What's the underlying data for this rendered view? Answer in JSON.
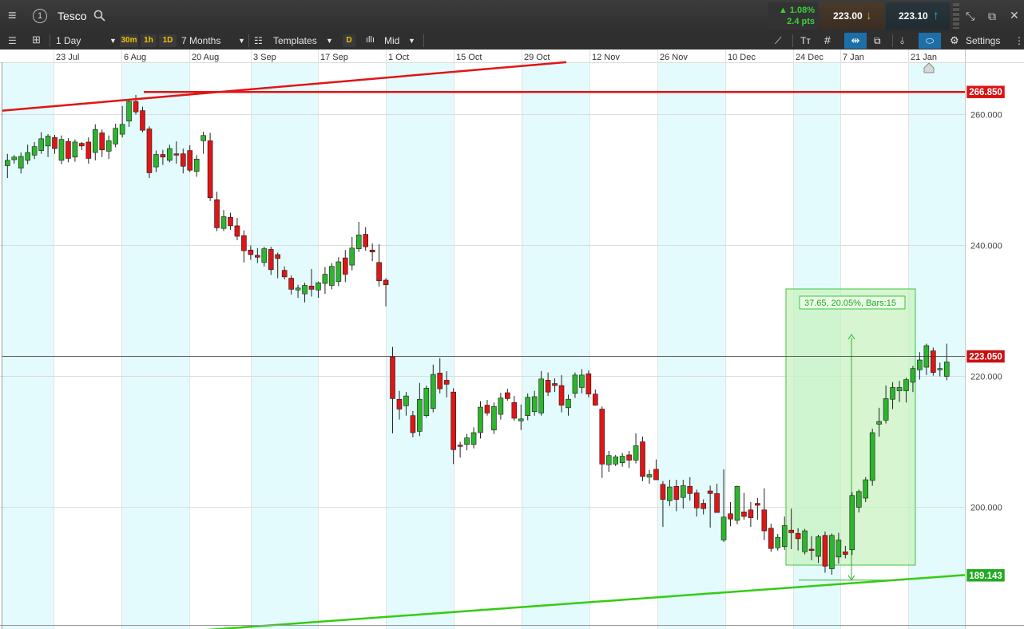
{
  "header": {
    "symbol": "Tesco",
    "change_pct": "▲ 1.08%",
    "change_pts": "2.4 pts",
    "sell_price": "223.00",
    "buy_price": "223.10",
    "sell_arrow": "↓",
    "buy_arrow": "↑"
  },
  "toolbar": {
    "interval": "1 Day",
    "quick_30m": "30m",
    "quick_1h": "1h",
    "quick_1d": "1D",
    "range": "7 Months",
    "templates": "Templates",
    "d_badge": "D",
    "price_type": "Mid",
    "text_tool": "Tт",
    "settings": "Settings"
  },
  "colors": {
    "up": "#2db52d",
    "down": "#e01515",
    "stripe": "#e4fbfd",
    "red_line": "#e01515",
    "green_line": "#33cc11",
    "measure_fill": "#c8f2c0",
    "current_badge": "#c81010",
    "support_badge": "#22aa22"
  },
  "chart_data": {
    "type": "candlestick",
    "x_ticks": [
      "23 Jul",
      "6 Aug",
      "20 Aug",
      "3 Sep",
      "17 Sep",
      "1 Oct",
      "15 Oct",
      "29 Oct",
      "12 Nov",
      "26 Nov",
      "10 Dec",
      "24 Dec",
      "7 Jan",
      "21 Jan"
    ],
    "y_ticks": [
      "260.000",
      "240.000",
      "220.000",
      "200.000"
    ],
    "y_tick_values": [
      260,
      240,
      220,
      200
    ],
    "ylim": [
      178,
      288
    ],
    "candles": [
      {
        "i": 0,
        "o": 252.2,
        "h": 254.0,
        "l": 250.3,
        "c": 253.0
      },
      {
        "i": 1,
        "o": 253.1,
        "h": 253.8,
        "l": 252.5,
        "c": 253.5
      },
      {
        "i": 2,
        "o": 251.8,
        "h": 254.2,
        "l": 251.0,
        "c": 253.6
      },
      {
        "i": 3,
        "o": 253.0,
        "h": 255.4,
        "l": 252.4,
        "c": 254.2
      },
      {
        "i": 4,
        "o": 253.8,
        "h": 255.8,
        "l": 253.2,
        "c": 255.1
      },
      {
        "i": 5,
        "o": 254.5,
        "h": 257.3,
        "l": 254.0,
        "c": 256.3
      },
      {
        "i": 6,
        "o": 255.2,
        "h": 257.0,
        "l": 253.5,
        "c": 256.7
      },
      {
        "i": 7,
        "o": 256.5,
        "h": 256.9,
        "l": 254.0,
        "c": 254.8
      },
      {
        "i": 8,
        "o": 253.0,
        "h": 256.8,
        "l": 252.4,
        "c": 256.2
      },
      {
        "i": 9,
        "o": 255.9,
        "h": 256.4,
        "l": 252.7,
        "c": 253.3
      },
      {
        "i": 10,
        "o": 253.5,
        "h": 256.2,
        "l": 252.8,
        "c": 255.8
      },
      {
        "i": 11,
        "o": 255.6,
        "h": 255.8,
        "l": 254.6,
        "c": 255.2
      },
      {
        "i": 12,
        "o": 255.8,
        "h": 256.5,
        "l": 252.5,
        "c": 253.3
      },
      {
        "i": 13,
        "o": 254.2,
        "h": 258.5,
        "l": 253.0,
        "c": 257.7
      },
      {
        "i": 14,
        "o": 257.2,
        "h": 257.7,
        "l": 253.5,
        "c": 254.6
      },
      {
        "i": 15,
        "o": 254.4,
        "h": 256.8,
        "l": 253.2,
        "c": 256.0
      },
      {
        "i": 16,
        "o": 255.5,
        "h": 258.6,
        "l": 255.0,
        "c": 257.9
      },
      {
        "i": 17,
        "o": 257.0,
        "h": 261.3,
        "l": 256.5,
        "c": 258.5
      },
      {
        "i": 18,
        "o": 259.0,
        "h": 262.2,
        "l": 258.1,
        "c": 262.0
      },
      {
        "i": 19,
        "o": 262.0,
        "h": 263.0,
        "l": 260.0,
        "c": 260.4
      },
      {
        "i": 20,
        "o": 260.6,
        "h": 261.2,
        "l": 257.3,
        "c": 257.6
      },
      {
        "i": 21,
        "o": 257.8,
        "h": 258.2,
        "l": 250.3,
        "c": 251.1
      },
      {
        "i": 22,
        "o": 252.0,
        "h": 254.5,
        "l": 251.2,
        "c": 253.9
      },
      {
        "i": 23,
        "o": 253.9,
        "h": 254.6,
        "l": 252.3,
        "c": 253.5
      },
      {
        "i": 24,
        "o": 253.0,
        "h": 255.4,
        "l": 252.7,
        "c": 254.8
      },
      {
        "i": 25,
        "o": 254.0,
        "h": 255.9,
        "l": 252.5,
        "c": 253.8
      },
      {
        "i": 26,
        "o": 254.0,
        "h": 254.8,
        "l": 251.0,
        "c": 252.1
      },
      {
        "i": 27,
        "o": 254.5,
        "h": 255.3,
        "l": 251.2,
        "c": 251.5
      },
      {
        "i": 28,
        "o": 251.3,
        "h": 253.8,
        "l": 250.5,
        "c": 253.2
      },
      {
        "i": 29,
        "o": 256.0,
        "h": 257.4,
        "l": 254.0,
        "c": 256.8
      },
      {
        "i": 30,
        "o": 256.0,
        "h": 257.2,
        "l": 246.8,
        "c": 247.3
      },
      {
        "i": 31,
        "o": 247.0,
        "h": 248.2,
        "l": 242.2,
        "c": 242.7
      },
      {
        "i": 32,
        "o": 242.6,
        "h": 245.4,
        "l": 242.2,
        "c": 244.4
      },
      {
        "i": 33,
        "o": 244.3,
        "h": 245.0,
        "l": 242.4,
        "c": 243.0
      },
      {
        "i": 34,
        "o": 243.0,
        "h": 244.2,
        "l": 240.8,
        "c": 241.4
      },
      {
        "i": 35,
        "o": 241.5,
        "h": 242.3,
        "l": 237.4,
        "c": 239.2
      },
      {
        "i": 36,
        "o": 239.3,
        "h": 240.0,
        "l": 237.8,
        "c": 238.6
      },
      {
        "i": 37,
        "o": 238.5,
        "h": 239.6,
        "l": 237.3,
        "c": 238.2
      },
      {
        "i": 38,
        "o": 237.4,
        "h": 239.8,
        "l": 236.8,
        "c": 239.5
      },
      {
        "i": 39,
        "o": 239.4,
        "h": 239.8,
        "l": 235.5,
        "c": 236.3
      },
      {
        "i": 40,
        "o": 238.6,
        "h": 238.9,
        "l": 235.0,
        "c": 238.0
      },
      {
        "i": 41,
        "o": 236.2,
        "h": 236.8,
        "l": 234.8,
        "c": 235.2
      },
      {
        "i": 42,
        "o": 235.0,
        "h": 235.4,
        "l": 232.5,
        "c": 233.3
      },
      {
        "i": 43,
        "o": 233.2,
        "h": 234.0,
        "l": 232.0,
        "c": 233.5
      },
      {
        "i": 44,
        "o": 232.6,
        "h": 234.3,
        "l": 231.3,
        "c": 233.9
      },
      {
        "i": 45,
        "o": 233.8,
        "h": 236.4,
        "l": 232.2,
        "c": 233.3
      },
      {
        "i": 46,
        "o": 233.2,
        "h": 234.5,
        "l": 232.0,
        "c": 234.3
      },
      {
        "i": 47,
        "o": 234.2,
        "h": 236.7,
        "l": 232.6,
        "c": 235.6
      },
      {
        "i": 48,
        "o": 233.9,
        "h": 237.3,
        "l": 233.3,
        "c": 236.8
      },
      {
        "i": 49,
        "o": 234.5,
        "h": 238.2,
        "l": 233.8,
        "c": 237.5
      },
      {
        "i": 50,
        "o": 238.1,
        "h": 239.3,
        "l": 234.4,
        "c": 235.6
      },
      {
        "i": 51,
        "o": 237.0,
        "h": 241.3,
        "l": 236.2,
        "c": 239.6
      },
      {
        "i": 52,
        "o": 239.5,
        "h": 243.6,
        "l": 239.0,
        "c": 241.6
      },
      {
        "i": 53,
        "o": 241.7,
        "h": 242.8,
        "l": 239.2,
        "c": 239.8
      },
      {
        "i": 54,
        "o": 239.3,
        "h": 240.3,
        "l": 237.6,
        "c": 239.0
      },
      {
        "i": 55,
        "o": 237.4,
        "h": 240.2,
        "l": 233.7,
        "c": 234.6
      },
      {
        "i": 56,
        "o": 234.7,
        "h": 235.0,
        "l": 230.7,
        "c": 234.0
      },
      {
        "i": 57,
        "o": 223.0,
        "h": 224.5,
        "l": 211.3,
        "c": 216.6
      },
      {
        "i": 58,
        "o": 216.5,
        "h": 217.8,
        "l": 213.4,
        "c": 215.0
      },
      {
        "i": 59,
        "o": 215.5,
        "h": 217.6,
        "l": 214.0,
        "c": 217.0
      },
      {
        "i": 60,
        "o": 214.0,
        "h": 214.7,
        "l": 210.7,
        "c": 211.4
      },
      {
        "i": 61,
        "o": 211.6,
        "h": 219.0,
        "l": 210.9,
        "c": 216.5
      },
      {
        "i": 62,
        "o": 214.0,
        "h": 218.6,
        "l": 213.7,
        "c": 218.2
      },
      {
        "i": 63,
        "o": 215.1,
        "h": 221.8,
        "l": 214.5,
        "c": 220.3
      },
      {
        "i": 64,
        "o": 220.5,
        "h": 222.8,
        "l": 217.4,
        "c": 218.1
      },
      {
        "i": 65,
        "o": 219.4,
        "h": 220.8,
        "l": 216.8,
        "c": 218.8
      },
      {
        "i": 66,
        "o": 217.6,
        "h": 218.2,
        "l": 206.6,
        "c": 208.8
      },
      {
        "i": 67,
        "o": 209.5,
        "h": 210.0,
        "l": 207.6,
        "c": 209.3
      },
      {
        "i": 68,
        "o": 209.6,
        "h": 211.2,
        "l": 208.7,
        "c": 210.6
      },
      {
        "i": 69,
        "o": 209.6,
        "h": 212.2,
        "l": 209.0,
        "c": 211.4
      },
      {
        "i": 70,
        "o": 211.4,
        "h": 216.2,
        "l": 210.5,
        "c": 215.3
      },
      {
        "i": 71,
        "o": 215.6,
        "h": 216.4,
        "l": 214.0,
        "c": 214.4
      },
      {
        "i": 72,
        "o": 211.8,
        "h": 216.0,
        "l": 211.2,
        "c": 215.4
      },
      {
        "i": 73,
        "o": 214.2,
        "h": 217.5,
        "l": 213.4,
        "c": 216.7
      },
      {
        "i": 74,
        "o": 217.5,
        "h": 218.1,
        "l": 216.3,
        "c": 216.6
      },
      {
        "i": 75,
        "o": 216.0,
        "h": 217.0,
        "l": 213.2,
        "c": 213.6
      },
      {
        "i": 76,
        "o": 213.2,
        "h": 215.7,
        "l": 211.8,
        "c": 213.5
      },
      {
        "i": 77,
        "o": 214.0,
        "h": 217.4,
        "l": 213.3,
        "c": 216.8
      },
      {
        "i": 78,
        "o": 214.6,
        "h": 217.8,
        "l": 214.0,
        "c": 216.9
      },
      {
        "i": 79,
        "o": 214.4,
        "h": 220.8,
        "l": 214.0,
        "c": 219.6
      },
      {
        "i": 80,
        "o": 219.4,
        "h": 220.6,
        "l": 217.0,
        "c": 217.6
      },
      {
        "i": 81,
        "o": 218.9,
        "h": 219.7,
        "l": 217.6,
        "c": 218.6
      },
      {
        "i": 82,
        "o": 218.6,
        "h": 220.2,
        "l": 214.5,
        "c": 215.6
      },
      {
        "i": 83,
        "o": 215.2,
        "h": 217.2,
        "l": 214.0,
        "c": 216.5
      },
      {
        "i": 84,
        "o": 217.4,
        "h": 220.6,
        "l": 216.7,
        "c": 220.2
      },
      {
        "i": 85,
        "o": 218.3,
        "h": 221.1,
        "l": 217.4,
        "c": 220.2
      },
      {
        "i": 86,
        "o": 220.4,
        "h": 220.9,
        "l": 216.8,
        "c": 217.3
      },
      {
        "i": 87,
        "o": 217.3,
        "h": 218.0,
        "l": 215.5,
        "c": 215.6
      },
      {
        "i": 88,
        "o": 215.0,
        "h": 215.4,
        "l": 204.5,
        "c": 206.6
      },
      {
        "i": 89,
        "o": 206.5,
        "h": 208.6,
        "l": 205.4,
        "c": 207.9
      },
      {
        "i": 90,
        "o": 206.6,
        "h": 208.0,
        "l": 206.3,
        "c": 207.7
      },
      {
        "i": 91,
        "o": 206.8,
        "h": 208.3,
        "l": 206.2,
        "c": 207.8
      },
      {
        "i": 92,
        "o": 208.0,
        "h": 208.6,
        "l": 206.0,
        "c": 207.2
      },
      {
        "i": 93,
        "o": 207.2,
        "h": 211.3,
        "l": 206.7,
        "c": 209.4
      },
      {
        "i": 94,
        "o": 210.0,
        "h": 210.8,
        "l": 204.0,
        "c": 204.7
      },
      {
        "i": 95,
        "o": 204.6,
        "h": 205.7,
        "l": 203.6,
        "c": 205.0
      },
      {
        "i": 96,
        "o": 205.8,
        "h": 207.3,
        "l": 204.5,
        "c": 204.2
      },
      {
        "i": 97,
        "o": 203.5,
        "h": 204.0,
        "l": 197.0,
        "c": 201.2
      },
      {
        "i": 98,
        "o": 201.0,
        "h": 204.2,
        "l": 200.2,
        "c": 203.1
      },
      {
        "i": 99,
        "o": 203.2,
        "h": 204.2,
        "l": 199.4,
        "c": 201.2
      },
      {
        "i": 100,
        "o": 201.5,
        "h": 204.2,
        "l": 199.8,
        "c": 203.3
      },
      {
        "i": 101,
        "o": 203.2,
        "h": 204.6,
        "l": 201.0,
        "c": 202.1
      },
      {
        "i": 102,
        "o": 202.2,
        "h": 202.7,
        "l": 198.6,
        "c": 199.9
      },
      {
        "i": 103,
        "o": 200.6,
        "h": 201.2,
        "l": 198.9,
        "c": 199.8
      },
      {
        "i": 104,
        "o": 202.5,
        "h": 203.3,
        "l": 196.9,
        "c": 202.1
      },
      {
        "i": 105,
        "o": 202.1,
        "h": 203.6,
        "l": 199.3,
        "c": 199.2
      },
      {
        "i": 106,
        "o": 195.0,
        "h": 205.8,
        "l": 194.7,
        "c": 198.5
      },
      {
        "i": 107,
        "o": 199.0,
        "h": 200.8,
        "l": 197.1,
        "c": 198.2
      },
      {
        "i": 108,
        "o": 198.0,
        "h": 203.3,
        "l": 197.4,
        "c": 203.2
      },
      {
        "i": 109,
        "o": 199.3,
        "h": 202.2,
        "l": 198.1,
        "c": 198.6
      },
      {
        "i": 110,
        "o": 199.6,
        "h": 200.8,
        "l": 197.0,
        "c": 198.4
      },
      {
        "i": 111,
        "o": 200.6,
        "h": 201.4,
        "l": 198.1,
        "c": 200.3
      },
      {
        "i": 112,
        "o": 199.6,
        "h": 202.9,
        "l": 195.0,
        "c": 196.4
      },
      {
        "i": 113,
        "o": 196.8,
        "h": 197.5,
        "l": 193.2,
        "c": 193.7
      },
      {
        "i": 114,
        "o": 193.8,
        "h": 195.9,
        "l": 193.4,
        "c": 195.4
      },
      {
        "i": 115,
        "o": 194.0,
        "h": 198.6,
        "l": 193.5,
        "c": 197.2
      },
      {
        "i": 116,
        "o": 196.5,
        "h": 199.8,
        "l": 193.6,
        "c": 196.1
      },
      {
        "i": 117,
        "o": 196.0,
        "h": 196.8,
        "l": 193.4,
        "c": 195.2
      },
      {
        "i": 118,
        "o": 193.2,
        "h": 196.7,
        "l": 192.8,
        "c": 196.4
      },
      {
        "i": 119,
        "o": 193.6,
        "h": 195.6,
        "l": 191.9,
        "c": 193.4
      },
      {
        "i": 120,
        "o": 192.5,
        "h": 195.8,
        "l": 191.5,
        "c": 195.5
      },
      {
        "i": 121,
        "o": 195.7,
        "h": 196.3,
        "l": 190.0,
        "c": 191.0
      },
      {
        "i": 122,
        "o": 190.6,
        "h": 196.0,
        "l": 189.7,
        "c": 195.7
      },
      {
        "i": 123,
        "o": 192.4,
        "h": 196.1,
        "l": 191.4,
        "c": 195.0
      },
      {
        "i": 124,
        "o": 193.2,
        "h": 194.1,
        "l": 192.2,
        "c": 192.8
      },
      {
        "i": 125,
        "o": 193.5,
        "h": 202.3,
        "l": 192.7,
        "c": 201.8
      },
      {
        "i": 126,
        "o": 200.0,
        "h": 202.7,
        "l": 199.2,
        "c": 202.4
      },
      {
        "i": 127,
        "o": 201.4,
        "h": 204.6,
        "l": 200.8,
        "c": 204.2
      },
      {
        "i": 128,
        "o": 204.1,
        "h": 212.0,
        "l": 203.3,
        "c": 211.4
      },
      {
        "i": 129,
        "o": 212.7,
        "h": 215.2,
        "l": 210.8,
        "c": 213.1
      },
      {
        "i": 130,
        "o": 213.3,
        "h": 218.6,
        "l": 212.8,
        "c": 216.6
      },
      {
        "i": 131,
        "o": 216.5,
        "h": 219.1,
        "l": 215.0,
        "c": 218.3
      },
      {
        "i": 132,
        "o": 217.8,
        "h": 219.3,
        "l": 216.1,
        "c": 218.3
      },
      {
        "i": 133,
        "o": 217.8,
        "h": 219.8,
        "l": 216.0,
        "c": 219.5
      },
      {
        "i": 134,
        "o": 219.1,
        "h": 221.6,
        "l": 217.6,
        "c": 221.2
      },
      {
        "i": 135,
        "o": 221.0,
        "h": 223.7,
        "l": 219.5,
        "c": 222.5
      },
      {
        "i": 136,
        "o": 221.4,
        "h": 225.0,
        "l": 220.2,
        "c": 224.7
      },
      {
        "i": 137,
        "o": 223.9,
        "h": 224.4,
        "l": 220.1,
        "c": 220.6
      },
      {
        "i": 138,
        "o": 221.0,
        "h": 222.1,
        "l": 220.0,
        "c": 221.2
      },
      {
        "i": 139,
        "o": 220.0,
        "h": 225.0,
        "l": 219.4,
        "c": 222.2
      }
    ],
    "trendlines": [
      {
        "color": "red",
        "y_start": 260.6,
        "y_end": 268.0,
        "span": "Jul to 29 Oct"
      },
      {
        "color": "red",
        "y_start": 263.4,
        "y_end": 263.4,
        "span": "horizontal"
      },
      {
        "color": "green",
        "y_start": 179.0,
        "y_end": 189.6,
        "span": "full"
      }
    ],
    "horizontal_line": 223.05,
    "price_badges": {
      "resistance": "266.850",
      "current": "223.050",
      "support": "189.143"
    },
    "measure": {
      "label": "37.65, 20.05%, Bars:15",
      "from": 189.0,
      "to": 226.65
    },
    "grid": true
  }
}
